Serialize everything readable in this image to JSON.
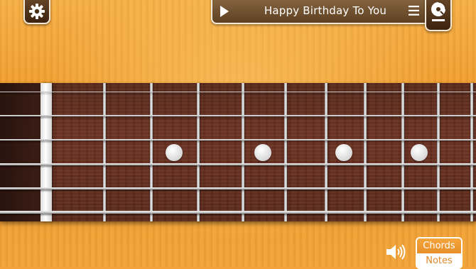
{
  "song_bar": {
    "title": "Happy Birthday To You",
    "play_icon": "play-icon",
    "menu_icon": "menu-icon"
  },
  "icons": {
    "settings": "gear-icon",
    "song_library": "disc-icon",
    "volume": "speaker-icon"
  },
  "mode_toggle": {
    "options": [
      "Chords",
      "Notes"
    ],
    "selected": "Notes"
  },
  "colors": {
    "background": "#f2a23a",
    "fretboard": "#6e3323",
    "accent": "#e8902a",
    "control_dark": "#5e3f20"
  }
}
